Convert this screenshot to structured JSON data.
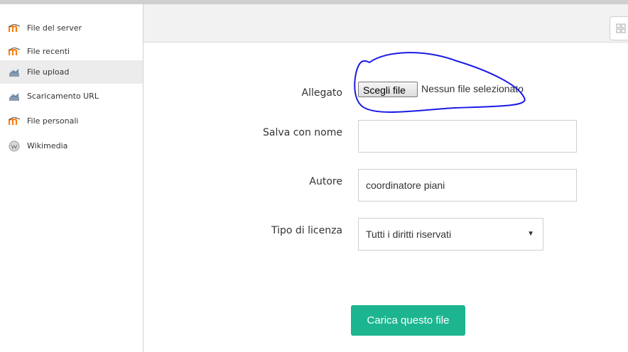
{
  "header": {
    "cut_text": ""
  },
  "sidebar": {
    "items": [
      {
        "label": "File del server",
        "icon": "moodle-icon",
        "active": false
      },
      {
        "label": "File recenti",
        "icon": "moodle-icon",
        "active": false
      },
      {
        "label": "File upload",
        "icon": "upload-icon",
        "active": true
      },
      {
        "label": "Scaricamento URL",
        "icon": "download-icon",
        "active": false
      },
      {
        "label": "File personali",
        "icon": "moodle-icon",
        "active": false
      },
      {
        "label": "Wikimedia",
        "icon": "wikimedia-icon",
        "active": false
      }
    ]
  },
  "form": {
    "attachment_label": "Allegato",
    "choose_file_label": "Scegli file",
    "no_file_text": "Nessun file selezionato",
    "save_as_label": "Salva con nome",
    "save_as_value": "",
    "author_label": "Autore",
    "author_value": "coordinatore piani",
    "license_label": "Tipo di licenza",
    "license_value": "Tutti i diritti riservati",
    "upload_label": "Carica questo file"
  },
  "colors": {
    "upload_button": "#1cb58f",
    "moodle_orange": "#f98012",
    "annotation_blue": "#1a1ae6"
  }
}
